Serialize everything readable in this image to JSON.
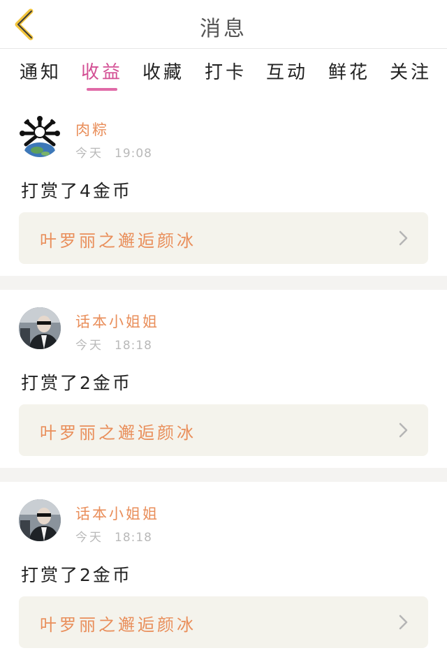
{
  "header": {
    "title": "消息",
    "back_icon": "chevron-left-icon",
    "accent_color": "#f2c53d"
  },
  "tabs": [
    {
      "label": "通知",
      "active": false
    },
    {
      "label": "收益",
      "active": true
    },
    {
      "label": "收藏",
      "active": false
    },
    {
      "label": "打卡",
      "active": false
    },
    {
      "label": "互动",
      "active": false
    },
    {
      "label": "鲜花",
      "active": false
    },
    {
      "label": "关注",
      "active": false
    }
  ],
  "colors": {
    "active_tab": "#d34f94",
    "username": "#e98e5a",
    "book_title": "#e98e5a",
    "book_box_bg": "#f4f3ec"
  },
  "messages": [
    {
      "username": "肉粽",
      "day": "今天",
      "time": "19:08",
      "text": "打赏了4金币",
      "book_title": "叶罗丽之邂逅颜冰",
      "avatar": "earth-avatar"
    },
    {
      "username": "话本小姐姐",
      "day": "今天",
      "time": "18:18",
      "text": "打赏了2金币",
      "book_title": "叶罗丽之邂逅颜冰",
      "avatar": "person-avatar"
    },
    {
      "username": "话本小姐姐",
      "day": "今天",
      "time": "18:18",
      "text": "打赏了2金币",
      "book_title": "叶罗丽之邂逅颜冰",
      "avatar": "person-avatar"
    }
  ]
}
